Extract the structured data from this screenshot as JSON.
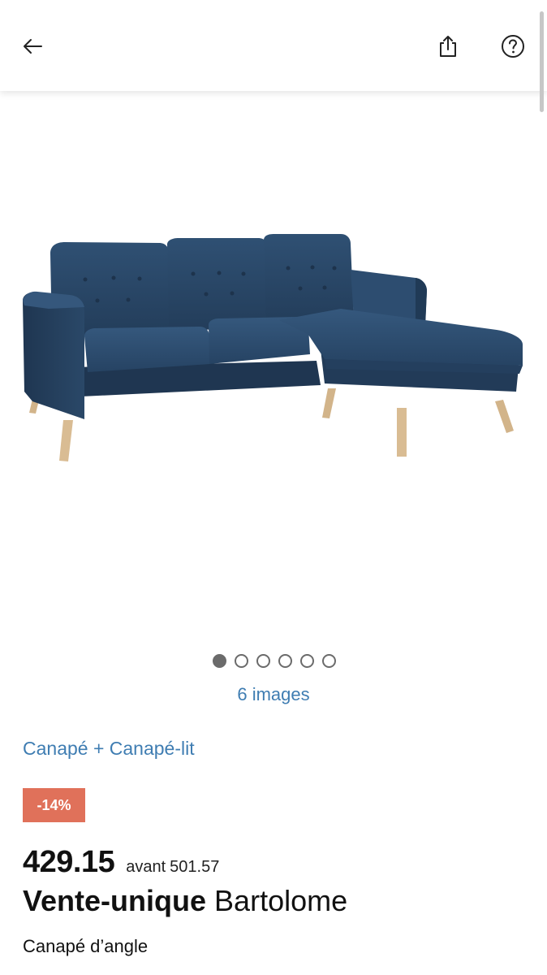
{
  "header": {
    "back_icon": "arrow-left-icon",
    "share_icon": "share-icon",
    "help_icon": "question-circle-icon"
  },
  "gallery": {
    "total_images": 6,
    "active_index": 0,
    "images_label": "6 images"
  },
  "product": {
    "category": "Canapé + Canapé-lit",
    "discount": "-14%",
    "price": "429.15",
    "old_price_prefix": "avant",
    "old_price": "501.57",
    "brand": "Vente-unique",
    "name": "Bartolome",
    "type": "Canapé d’angle"
  },
  "colors": {
    "link": "#3f7db2",
    "badge": "#e0715a",
    "sofa": "#2c4a6c",
    "legs": "#d2b48a"
  }
}
